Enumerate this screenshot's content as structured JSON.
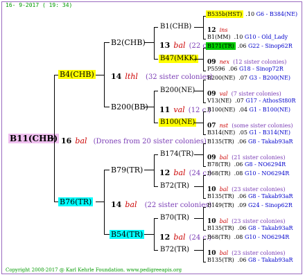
{
  "header": {
    "date": "16- 9-2017 ( 19: 34)"
  },
  "footer": {
    "copyright": "Copyright 2008-2017 @ Karl Kehrle Foundation.   www.pedigreeapis.org"
  },
  "queen": {
    "name": "B11(CHB)",
    "color": "#f0c0f0"
  },
  "root_drones": {
    "num": "16",
    "name": "bal",
    "text": "(Drones from 20 sister colonies)"
  },
  "gen1": [
    {
      "name": "B4(CHB)",
      "color": "#ffff00",
      "num": "14",
      "drone": "lthl",
      "sis": "(32 sister colonies)"
    },
    {
      "name": "B76(TR)",
      "color": "#00ffff",
      "num": "14",
      "drone": "bal",
      "sis": "(22 sister colonies)"
    }
  ],
  "gen2": [
    {
      "name": "B2(CHB)",
      "num": "13",
      "drone": "bal",
      "sis": "(22 c.)"
    },
    {
      "name": "B200(BB)",
      "num": "11",
      "drone": "val",
      "sis": "(12 c.)"
    },
    {
      "name": "B79(TR)",
      "num": "12",
      "drone": "bal",
      "sis": "(24 c.)"
    },
    {
      "name": "B54(TR)",
      "color": "#00ffff",
      "num": "12",
      "drone": "bal",
      "sis": "(24 c.)"
    }
  ],
  "gen3": [
    {
      "name": "B1(CHB)",
      "num": "12",
      "drone": "ins",
      "sis": ""
    },
    {
      "name": "B47(MKK)",
      "color": "#ffff00",
      "num": "09",
      "drone": "nex",
      "sis": "(12 sister colonies)"
    },
    {
      "name": "B200(NE)",
      "num": "09",
      "drone": "val",
      "sis": "(7 sister colonies)"
    },
    {
      "name": "B100(NE)",
      "color": "#ffff00",
      "num": "07",
      "drone": "nst",
      "sis": "(some sister colonies)"
    },
    {
      "name": "B174(TR)",
      "num": "09",
      "drone": "bal",
      "sis": "(21 sister colonies)"
    },
    {
      "name": "B72(TR)",
      "num": "10",
      "drone": "bal",
      "sis": "(23 sister colonies)"
    },
    {
      "name": "B70(TR)",
      "num": "10",
      "drone": "bal",
      "sis": "(23 sister colonies)"
    },
    {
      "name": "B72(TR)",
      "num": "10",
      "drone": "bal",
      "sis": "(23 sister colonies)"
    }
  ],
  "gen4": [
    {
      "name": "B535b(HST)",
      "color": "#ffff00",
      "year": ".10",
      "code": "G6 - B384(NE)"
    },
    {
      "name": "B1(MM)",
      "year": ".10",
      "code": "G10 - Old_Lady"
    },
    {
      "name": "B171(TR)",
      "color": "#00cc00",
      "year": ".06",
      "code": "G22 - Sinop62R"
    },
    {
      "name": "P5596",
      "year": ".06",
      "code": "G18 - Sinop72R"
    },
    {
      "name": "B200(NE)",
      "year": ".07",
      "code": "G3 - B200(NE)"
    },
    {
      "name": "V13(NE)",
      "year": ".07",
      "code": "G17 - AthosSt80R"
    },
    {
      "name": "B100(NE)",
      "year": ".04",
      "code": "G1 - B100(NE)"
    },
    {
      "name": "B314(NE)",
      "year": ".05",
      "code": "G1 - B314(NE)"
    },
    {
      "name": "B135(TR)",
      "year": ".06",
      "code": "G8 - Takab93aR"
    },
    {
      "name": "B78(TR)",
      "year": ".06",
      "code": "G8 - NO6294R"
    },
    {
      "name": "B68(TR)",
      "year": ".08",
      "code": "G10 - NO6294R"
    },
    {
      "name": "B135(TR)",
      "year": ".06",
      "code": "G8 - Takab93aR"
    },
    {
      "name": "B149(TR)",
      "year": ".09",
      "code": "G24 - Sinop62R"
    },
    {
      "name": "B135(TR)",
      "year": ".06",
      "code": "G8 - Takab93aR"
    },
    {
      "name": "B68(TR)",
      "year": ".08",
      "code": "G10 - NO6294R"
    },
    {
      "name": "B135(TR)",
      "year": ".06",
      "code": "G8 - Takab93aR"
    }
  ]
}
